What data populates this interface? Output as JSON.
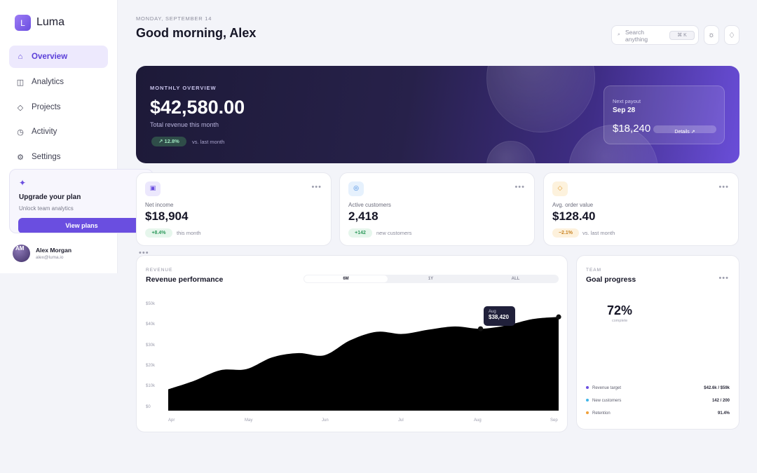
{
  "sidebar": {
    "brand": {
      "logo_letter": "L",
      "name": "Luma"
    },
    "nav": [
      {
        "label": "Overview",
        "icon": "home-icon",
        "glyph": "⌂",
        "active": true
      },
      {
        "label": "Analytics",
        "icon": "columns-icon",
        "glyph": "◫",
        "active": false
      },
      {
        "label": "Projects",
        "icon": "diamond-icon",
        "glyph": "◇",
        "active": false
      },
      {
        "label": "Activity",
        "icon": "clock-icon",
        "glyph": "◷",
        "active": false
      },
      {
        "label": "Settings",
        "icon": "gear-icon",
        "glyph": "⚙",
        "active": false
      }
    ],
    "upgrade": {
      "glyph": "✦",
      "title": "Upgrade your plan",
      "subtitle": "Unlock team analytics",
      "button": "View plans"
    },
    "user": {
      "initials": "AM",
      "name": "Alex Morgan",
      "email": "alex@luma.io"
    }
  },
  "header": {
    "date": "MONDAY, SEPTEMBER 14",
    "greeting": "Good morning, Alex",
    "search": {
      "placeholder": "Search anything",
      "shortcut": "⌘ K"
    },
    "icons": {
      "theme_glyph": "☼",
      "notify_glyph": "♢"
    }
  },
  "hero": {
    "label": "MONTHLY OVERVIEW",
    "amount": "$42,580.00",
    "subtitle": "Total revenue this month",
    "change": "↗ 12.8%",
    "change_note": "vs. last month",
    "payout": {
      "label": "Next payout",
      "date": "Sep 28",
      "amount": "$18,240",
      "button": "Details ↗"
    }
  },
  "stats": [
    {
      "label": "Net income",
      "value": "$18,904",
      "badge": "+8.4%",
      "note": "this month",
      "icon": "wallet-icon",
      "glyph": "▣",
      "tone": "green"
    },
    {
      "label": "Active customers",
      "value": "2,418",
      "badge": "+142",
      "note": "new customers",
      "icon": "users-icon",
      "glyph": "◎",
      "tone": "green"
    },
    {
      "label": "Avg. order value",
      "value": "$128.40",
      "badge": "−2.1%",
      "note": "vs. last month",
      "icon": "tag-icon",
      "glyph": "◇",
      "tone": "amber"
    }
  ],
  "more_glyph": "•••",
  "revenue": {
    "label": "REVENUE",
    "title": "Revenue performance",
    "ranges": [
      "6M",
      "1Y",
      "ALL"
    ],
    "active_range": "6M",
    "tooltip": {
      "month": "Aug",
      "value": "$38,420"
    }
  },
  "chart_data": {
    "type": "area",
    "title": "Revenue performance",
    "categories": [
      "Apr",
      "May",
      "Jun",
      "Jul",
      "Aug",
      "Sep"
    ],
    "y_ticks": [
      "$0",
      "$10k",
      "$20k",
      "$30k",
      "$40k",
      "$50k"
    ],
    "ylim": [
      0,
      50000
    ],
    "x": [
      0,
      0.33,
      0.67,
      1,
      1.33,
      1.67,
      2,
      2.33,
      2.67,
      3,
      3.33,
      3.67,
      4,
      4.33,
      4.67,
      5
    ],
    "values": [
      10000,
      14000,
      19000,
      19500,
      25000,
      27000,
      26000,
      33000,
      37000,
      36000,
      38000,
      39500,
      38420,
      40000,
      43000,
      44000
    ],
    "highlight": {
      "x": 4,
      "value": 38420
    },
    "fill": "#000000"
  },
  "goal": {
    "label": "TEAM",
    "title": "Goal progress",
    "percent": "72%",
    "percent_sub": "complete",
    "items": [
      {
        "label": "Revenue target",
        "value": "$42.6k / $59k",
        "color": "#6a4ee0"
      },
      {
        "label": "New customers",
        "value": "142 / 200",
        "color": "#3fb5e8"
      },
      {
        "label": "Retention",
        "value": "91.4%",
        "color": "#f0a13a"
      }
    ]
  }
}
